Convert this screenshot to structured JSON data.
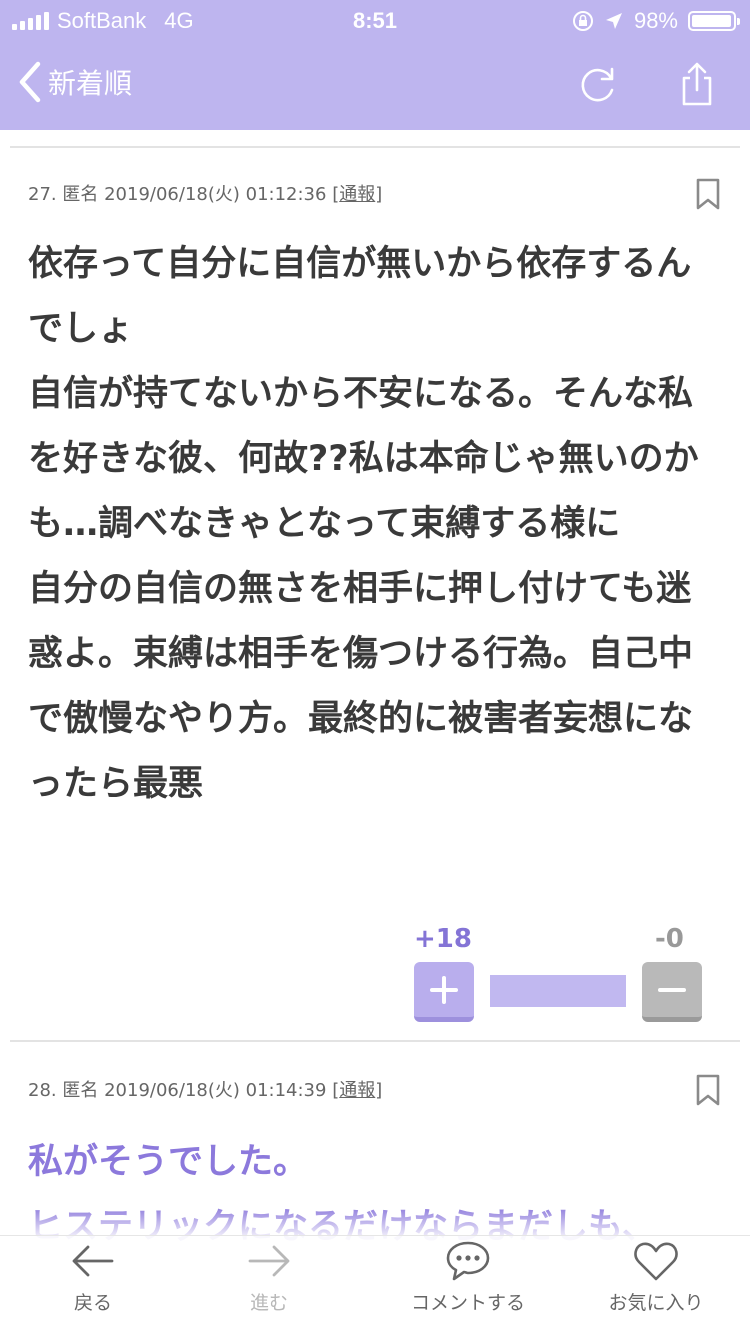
{
  "status_bar": {
    "carrier": "SoftBank",
    "network": "4G",
    "time": "8:51",
    "battery_text": "98%",
    "battery_level": 0.98
  },
  "nav": {
    "back_label": "新着順",
    "icons": [
      "chevron-left-icon",
      "refresh-icon",
      "share-icon"
    ]
  },
  "comments": [
    {
      "number": "27.",
      "name": "匿名",
      "date": "2019/06/18(火) 01:12:36",
      "report_open": "[",
      "report_label": "通報",
      "report_close": "]",
      "body": "依存って自分に自信が無いから依存するんでしょ\n自信が持てないから不安になる。そんな私を好きな彼、何故??私は本命じゃ無いのかも…調べなきゃとなって束縛する様に\n自分の自信の無さを相手に押し付けても迷惑よ。束縛は相手を傷つける行為。自己中で傲慢なやり方。最終的に被害者妄想になったら最悪",
      "plus_count": "+18",
      "minus_count": "-0",
      "plus_ratio": 1.0
    },
    {
      "number": "28.",
      "name": "匿名",
      "date": "2019/06/18(火) 01:14:39",
      "report_open": "[",
      "report_label": "通報",
      "report_close": "]",
      "body": "私がそうでした。\nヒステリックになるだけならまだしも、"
    }
  ],
  "tab_bar": {
    "items": [
      {
        "label": "戻る",
        "icon": "arrow-left-icon",
        "enabled": true
      },
      {
        "label": "進む",
        "icon": "arrow-right-icon",
        "enabled": false
      },
      {
        "label": "コメントする",
        "icon": "speech-bubble-icon",
        "enabled": true
      },
      {
        "label": "お気に入り",
        "icon": "heart-icon",
        "enabled": true
      }
    ]
  },
  "colors": {
    "header_bg": "#beb5ef",
    "accent": "#8474d6",
    "body_text": "#3a3a3a",
    "purple_text": "#8c79dc",
    "minus_gray": "#b9b9b9"
  }
}
